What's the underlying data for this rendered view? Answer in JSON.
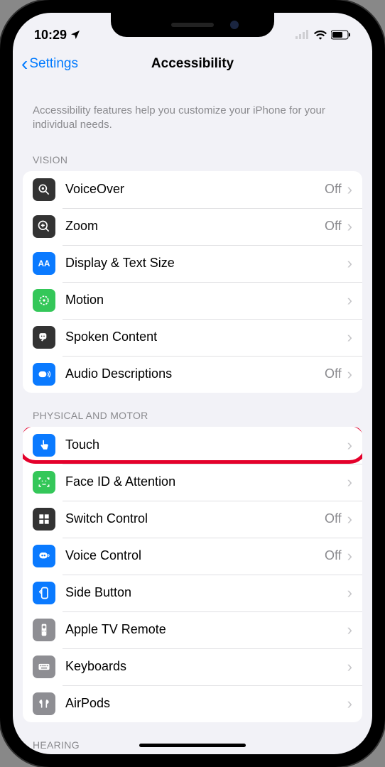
{
  "status": {
    "time": "10:29"
  },
  "nav": {
    "back": "Settings",
    "title": "Accessibility"
  },
  "intro": "Accessibility features help you customize your iPhone for your individual needs.",
  "sections": {
    "vision": {
      "header": "VISION"
    },
    "motor": {
      "header": "PHYSICAL AND MOTOR"
    },
    "hearing": {
      "header": "HEARING"
    }
  },
  "rows": {
    "voiceover": {
      "label": "VoiceOver",
      "value": "Off"
    },
    "zoom": {
      "label": "Zoom",
      "value": "Off"
    },
    "display": {
      "label": "Display & Text Size"
    },
    "motion": {
      "label": "Motion"
    },
    "spoken": {
      "label": "Spoken Content"
    },
    "audio": {
      "label": "Audio Descriptions",
      "value": "Off"
    },
    "touch": {
      "label": "Touch"
    },
    "faceid": {
      "label": "Face ID & Attention"
    },
    "switch": {
      "label": "Switch Control",
      "value": "Off"
    },
    "voice": {
      "label": "Voice Control",
      "value": "Off"
    },
    "side": {
      "label": "Side Button"
    },
    "appletv": {
      "label": "Apple TV Remote"
    },
    "keyboards": {
      "label": "Keyboards"
    },
    "airpods": {
      "label": "AirPods"
    }
  }
}
